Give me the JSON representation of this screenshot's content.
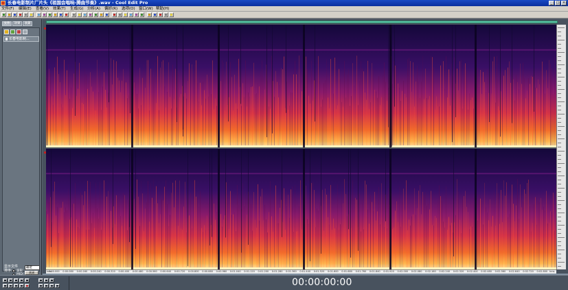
{
  "window": {
    "title": "长春电影制片厂片头《祖国会唱响-腾曲节奏》.wav - Cool Edit Pro",
    "minimize_label": "_",
    "maximize_label": "□",
    "close_label": "×"
  },
  "menu": {
    "items": [
      "文件(F)",
      "编辑(E)",
      "查看(V)",
      "效果(T)",
      "生成(G)",
      "分析(A)",
      "偏好(R)",
      "选项(O)",
      "窗口(W)",
      "帮助(H)"
    ]
  },
  "left_panel": {
    "tabs": [
      "文件",
      "效果",
      "收藏"
    ],
    "file_item": "长春电影制...",
    "show_files_label": "显示文件",
    "sort_label": "排序:",
    "sort_value": "最近",
    "radio_wave": "波形",
    "radio_midi": "MIDI",
    "btn_close_label": "关闭",
    "btn_options_label": "选项"
  },
  "timeline": {
    "labels": [
      "hms",
      "0:00.000",
      "0:00.080",
      "0:00.160",
      "0:00.240",
      "0:00.320",
      "0:00.400",
      "0:00.480",
      "0:00.560",
      "0:00.640",
      "0:00.720",
      "0:00.800",
      "0:00.880",
      "0:00.960",
      "0:01.040",
      "0:01.120",
      "0:01.200",
      "0:01.280",
      "0:01.360",
      "0:01.440",
      "0:01.520",
      "0:01.600",
      "0:01.680",
      "0:01.760",
      "0:01.840",
      "0:01.920",
      "0:02.000",
      "0:02.080",
      "0:02.160",
      "0:02.240",
      "0:02.320",
      "0:02.400",
      "0:02.480",
      "0:02.560",
      "0:02.640",
      "0:02.720",
      "0:02.800",
      "hms"
    ]
  },
  "status": {
    "time": "00:00:00:00"
  },
  "colors": {
    "overview": "#5cc6a6",
    "spectrogram_low": "#1a0a3e",
    "spectrogram_mid": "#c02060",
    "spectrogram_high": "#ffd060"
  }
}
